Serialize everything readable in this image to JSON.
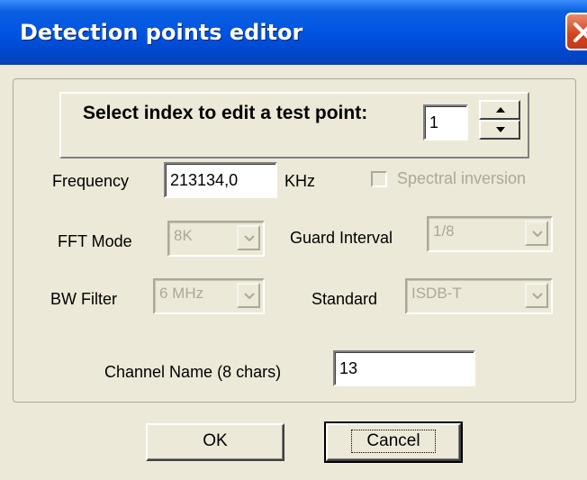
{
  "window": {
    "title": "Detection points editor"
  },
  "index": {
    "label": "Select index to edit a test point:",
    "value": "1"
  },
  "frequency": {
    "label": "Frequency",
    "value": "213134,0",
    "unit": "KHz"
  },
  "spectral_inversion": {
    "label": "Spectral inversion",
    "checked": false
  },
  "fft_mode": {
    "label": "FFT Mode",
    "value": "8K"
  },
  "guard_interval": {
    "label": "Guard Interval",
    "value": "1/8"
  },
  "bw_filter": {
    "label": "BW Filter",
    "value": "6 MHz"
  },
  "standard": {
    "label": "Standard",
    "value": "ISDB-T"
  },
  "channel_name": {
    "label": "Channel Name (8 chars)",
    "value": "13"
  },
  "buttons": {
    "ok": "OK",
    "cancel": "Cancel"
  },
  "icons": {
    "close": "close-icon",
    "spin_up": "up-arrow-icon",
    "spin_down": "down-arrow-icon",
    "dropdown": "chevron-down-icon"
  },
  "colors": {
    "title_bar": "#0054e3",
    "dialog_bg": "#ece9d8",
    "close_button": "#d2421d",
    "disabled_text": "#aca899"
  }
}
